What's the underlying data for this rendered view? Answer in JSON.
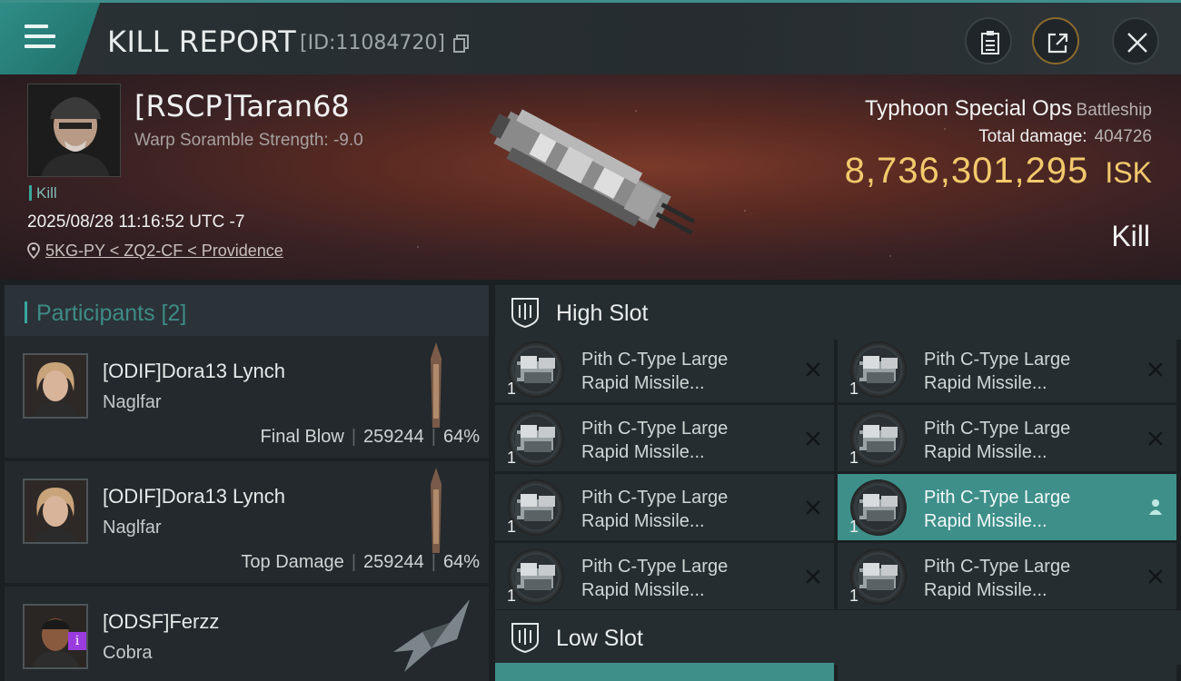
{
  "header": {
    "title": "KILL REPORT",
    "report_id": "[ID:11084720]"
  },
  "victim": {
    "name": "[RSCP]Taran68",
    "scramble": "Warp Soramble Strength: -9.0",
    "tag": "Kill",
    "time": "2025/08/28 11:16:52 UTC -7",
    "location": "5KG-PY < ZQ2-CF < Providence",
    "ship_name": "Typhoon Special Ops",
    "ship_class": "Battleship",
    "damage_label": "Total damage:",
    "damage_value": "404726",
    "isk_value": "8,736,301,295",
    "isk_unit": "ISK",
    "result": "Kill"
  },
  "participants": {
    "header": "Participants [2]",
    "items": [
      {
        "name": "[ODIF]Dora13 Lynch",
        "ship": "Naglfar",
        "role": "Final Blow",
        "damage": "259244",
        "percent": "64%"
      },
      {
        "name": "[ODIF]Dora13 Lynch",
        "ship": "Naglfar",
        "role": "Top Damage",
        "damage": "259244",
        "percent": "64%"
      },
      {
        "name": "[ODSF]Ferzz",
        "ship": "Cobra",
        "badge": "i"
      }
    ]
  },
  "high_slot": {
    "label": "High Slot",
    "modules": [
      {
        "line1": "Pith C-Type Large",
        "line2": "Rapid Missile...",
        "qty": "1"
      },
      {
        "line1": "Pith C-Type Large",
        "line2": "Rapid Missile...",
        "qty": "1"
      },
      {
        "line1": "Pith C-Type Large",
        "line2": "Rapid Missile...",
        "qty": "1"
      },
      {
        "line1": "Pith C-Type Large",
        "line2": "Rapid Missile...",
        "qty": "1"
      },
      {
        "line1": "Pith C-Type Large",
        "line2": "Rapid Missile...",
        "qty": "1"
      },
      {
        "line1": "Pith C-Type Large",
        "line2": "Rapid Missile...",
        "qty": "1"
      },
      {
        "line1": "Pith C-Type Large",
        "line2": "Rapid Missile...",
        "qty": "1"
      },
      {
        "line1": "Pith C-Type Large",
        "line2": "Rapid Missile...",
        "qty": "1"
      }
    ]
  },
  "low_slot": {
    "label": "Low Slot"
  },
  "colors": {
    "accent": "#3e8f8a",
    "isk": "#f2c96c",
    "badge": "#9a3be0"
  }
}
